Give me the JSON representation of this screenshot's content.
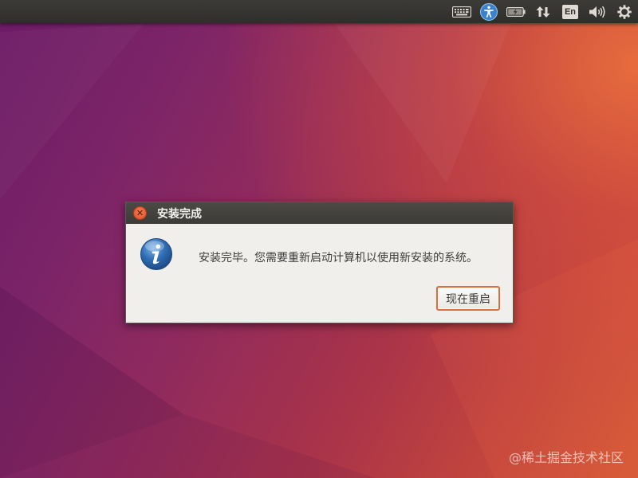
{
  "topbar": {
    "indicators": [
      {
        "icon": "keyboard-icon"
      },
      {
        "icon": "accessibility-icon"
      },
      {
        "icon": "battery-icon"
      },
      {
        "icon": "network-arrows-icon"
      },
      {
        "icon": "input-language-icon",
        "label": "En"
      },
      {
        "icon": "volume-icon"
      },
      {
        "icon": "power-gear-icon"
      }
    ]
  },
  "dialog": {
    "title": "安装完成",
    "icon": "info-icon",
    "message": "安装完毕。您需要重新启动计算机以使用新安装的系统。",
    "restart_button": "现在重启"
  },
  "watermark": "@稀土掘金技术社区",
  "colors": {
    "accent_orange": "#e06c3a",
    "topbar": "#3c3b37",
    "dialog_bg": "#f1efeb",
    "info_blue": "#2e6db4"
  }
}
